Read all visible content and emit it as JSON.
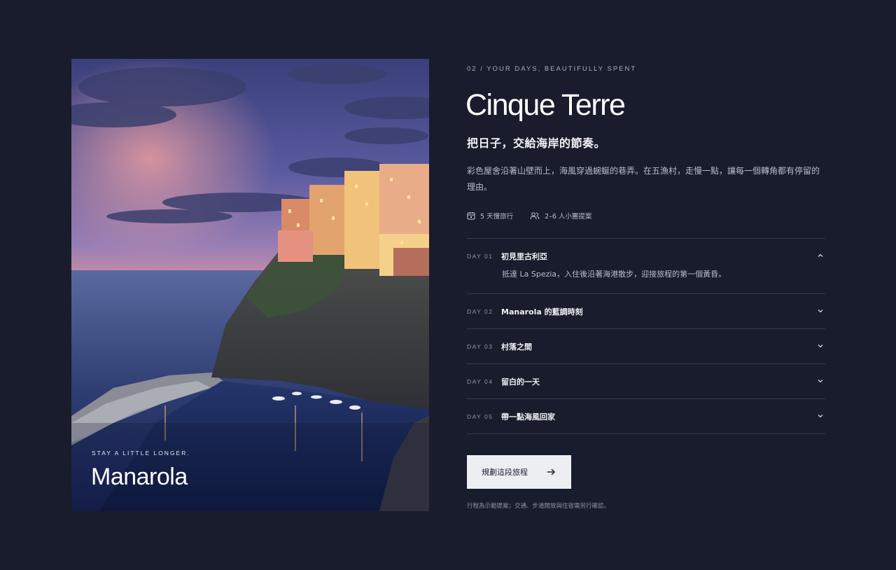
{
  "photo": {
    "caption": "STAY A LITTLE LONGER.",
    "title": "Manarola"
  },
  "section": {
    "eyebrow": "02 / YOUR DAYS, BEAUTIFULLY SPENT",
    "title": "Cinque Terre",
    "subtitle": "把日子，交給海岸的節奏。",
    "description": "彩色屋舍沿著山壁而上，海風穿過蜿蜒的巷弄。在五漁村，走慢一點，讓每一個轉角都有停留的理由。"
  },
  "meta": {
    "duration": "5 天慢旅行",
    "group": "2–6 人小團提案"
  },
  "itinerary": [
    {
      "day": "DAY 01",
      "title": "初見里古利亞",
      "expanded": true,
      "detail": "抵達 La Spezia，入住後沿著海港散步，迎接旅程的第一個黃昏。"
    },
    {
      "day": "DAY 02",
      "title": "Manarola 的藍調時刻",
      "expanded": false
    },
    {
      "day": "DAY 03",
      "title": "村落之間",
      "expanded": false
    },
    {
      "day": "DAY 04",
      "title": "留白的一天",
      "expanded": false
    },
    {
      "day": "DAY 05",
      "title": "帶一點海風回家",
      "expanded": false
    }
  ],
  "cta": {
    "label": "規劃這段旅程",
    "icon": "arrow-right-icon"
  },
  "note": "行程為示範提案；交通、步道開放與住宿需另行確認。",
  "colors": {
    "background": "#181c2c",
    "button": "#eceef2",
    "divider": "#353a4c"
  }
}
